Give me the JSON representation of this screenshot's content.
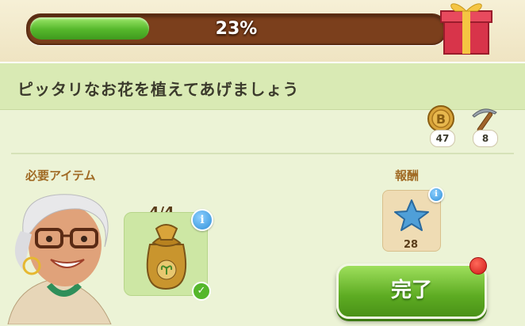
{
  "header": {
    "title_peek": "",
    "progress_percent": 23,
    "progress_text": "23%"
  },
  "quest": {
    "description": "ピッタリなお花を植えてあげましょう"
  },
  "resources": [
    {
      "icon": "coin-b-icon",
      "count": "47"
    },
    {
      "icon": "pickaxe-icon",
      "count": "8"
    }
  ],
  "required": {
    "label": "必要アイテム",
    "item_icon": "seed-bag-icon",
    "count": "4/4",
    "info": "i"
  },
  "reward": {
    "label": "報酬",
    "icon": "blue-star-icon",
    "count": "28",
    "info": "i"
  },
  "complete_button": {
    "label": "完了"
  },
  "colors": {
    "progress_fill": "#55b72b",
    "progress_track": "#7b3f1c",
    "button": "#5dab22",
    "accent_label": "#a06a24"
  }
}
